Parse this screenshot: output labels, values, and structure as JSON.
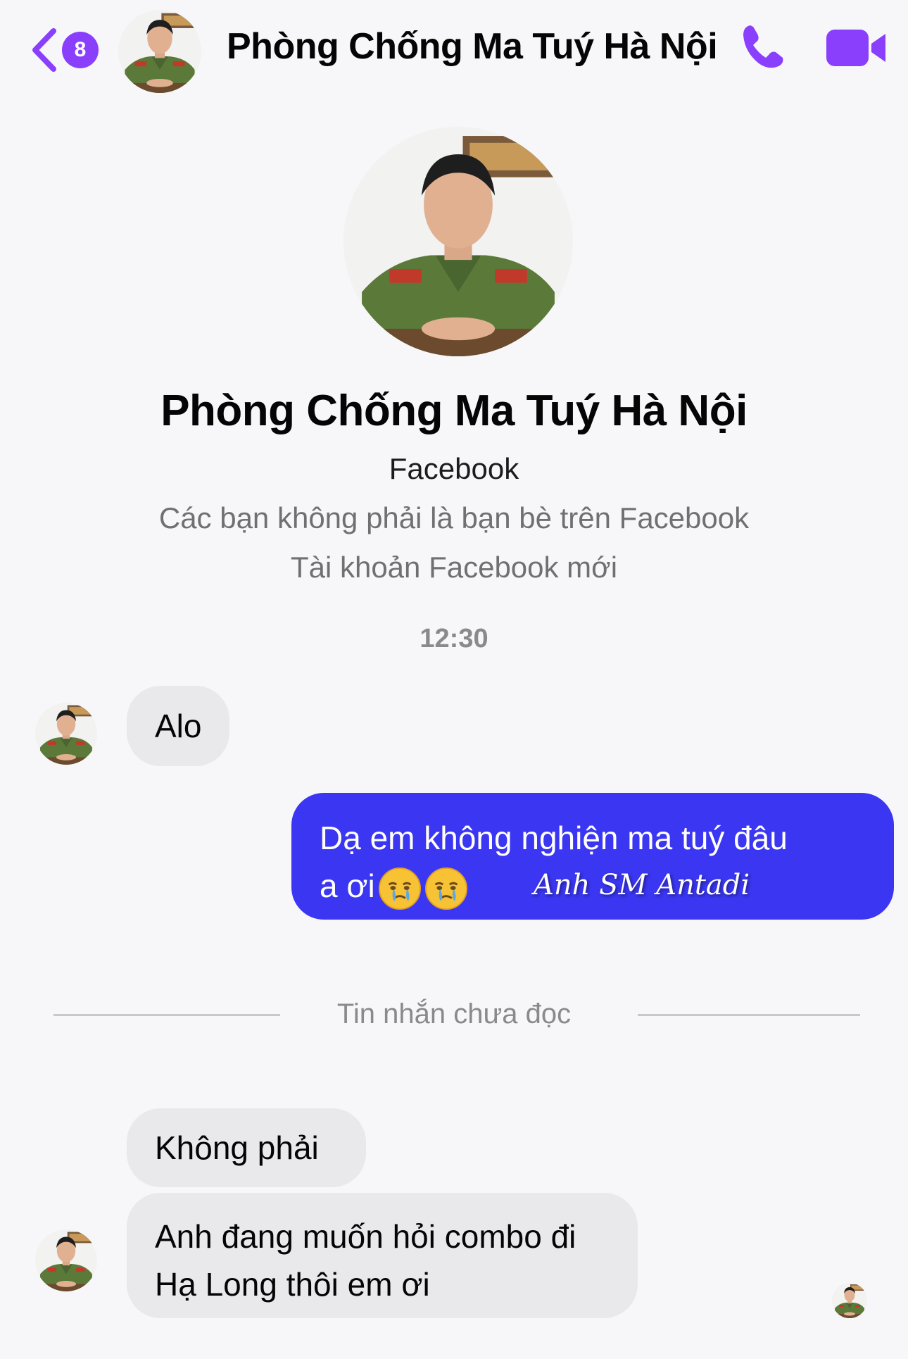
{
  "header": {
    "back_count": "8",
    "title": "Phòng Chống Ma Tuý Hà Nội",
    "accent_color": "#8a3ffc",
    "icons": [
      "chevron-left-icon",
      "phone-icon",
      "video-camera-icon"
    ]
  },
  "profile": {
    "name": "Phòng Chống Ma Tuý Hà Nội",
    "platform": "Facebook",
    "not_friends": "Các bạn không phải là bạn bè trên Facebook",
    "new_account": "Tài khoản Facebook mới"
  },
  "timestamp": "12:30",
  "messages": {
    "m1": "Alo",
    "m2_line1": "Dạ em không nghiện ma tuý đâu",
    "m2_line2": "a ơi",
    "m2_emojis": [
      "face-holding-back-tears-icon",
      "face-holding-back-tears-icon"
    ],
    "watermark": "Anh SM Antadi",
    "unread_divider": "Tin nhắn chưa đọc",
    "m3": "Không phải",
    "m4_line1": "Anh đang muốn hỏi combo đi",
    "m4_line2": "Hạ Long thôi em ơi"
  },
  "colors": {
    "outgoing_bubble": "#3a36f2",
    "incoming_bubble": "#e9e9ec"
  }
}
